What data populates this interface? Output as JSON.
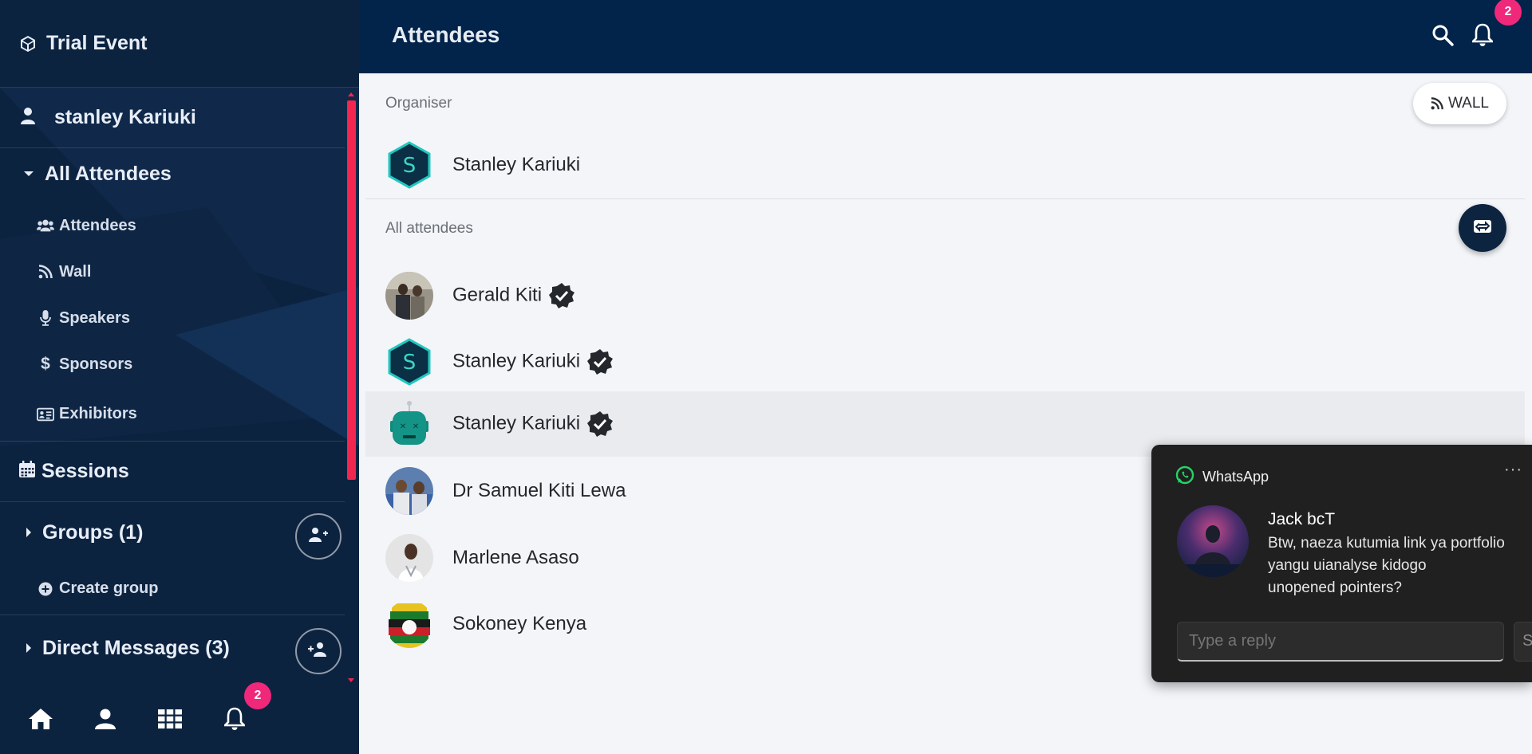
{
  "sidebar": {
    "event_title": "Trial Event",
    "user_name": "stanley Kariuki",
    "all_attendees_label": "All Attendees",
    "items": [
      {
        "label": "Attendees",
        "icon": "users-icon"
      },
      {
        "label": "Wall",
        "icon": "rss-icon"
      },
      {
        "label": "Speakers",
        "icon": "microphone-icon"
      },
      {
        "label": "Sponsors",
        "icon": "dollar-icon"
      },
      {
        "label": "Exhibitors",
        "icon": "id-card-icon"
      }
    ],
    "sessions_label": "Sessions",
    "groups_label": "Groups (1)",
    "create_group_label": "Create group",
    "direct_messages_label": "Direct Messages (3)",
    "bottom_nav": {
      "notification_count": "2"
    }
  },
  "topbar": {
    "title": "Attendees",
    "notification_count": "2"
  },
  "main": {
    "wall_button_label": "WALL",
    "organiser_header": "Organiser",
    "organiser": {
      "name": "Stanley Kariuki",
      "initial": "S"
    },
    "attendees_header": "All attendees",
    "attendees": [
      {
        "name": "Gerald Kiti",
        "verified": true
      },
      {
        "name": "Stanley Kariuki",
        "verified": true,
        "initial": "S"
      },
      {
        "name": "Stanley Kariuki",
        "verified": true
      },
      {
        "name": "Dr Samuel Kiti Lewa",
        "verified": false
      },
      {
        "name": "Marlene Asaso",
        "verified": false
      },
      {
        "name": "Sokoney Kenya",
        "verified": false
      }
    ]
  },
  "toast": {
    "app_name": "WhatsApp",
    "more_label": "···",
    "sender": "Jack bcT",
    "message_lines": [
      "Btw, naeza kutumia link ya portfolio",
      "yangu uianalyse kidogo",
      "unopened pointers?"
    ],
    "reply_placeholder": "Type a reply",
    "send_label": "Send"
  },
  "colors": {
    "sidebar_bg": "#0c2340",
    "topbar_bg": "#02234a",
    "accent_red": "#f2264f",
    "badge_pink": "#f0287a",
    "hex_avatar_border": "#3ad6c3",
    "whatsapp_green": "#25d366"
  }
}
